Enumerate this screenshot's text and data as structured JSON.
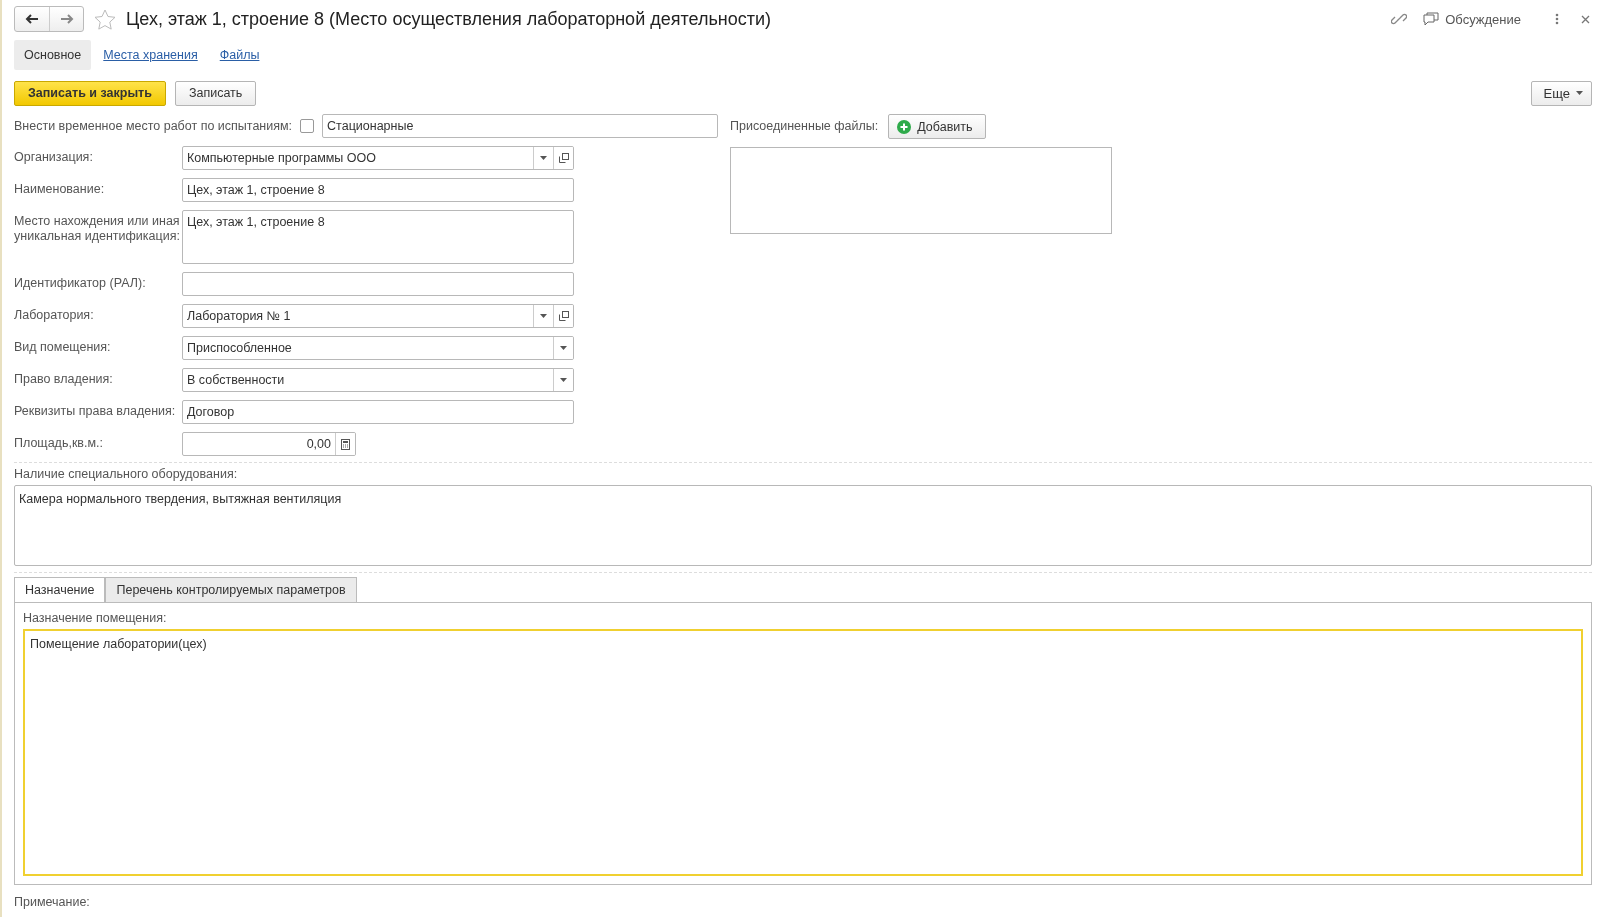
{
  "window": {
    "title": "Цех, этаж 1, строение 8 (Место осуществления лабораторной деятельности)",
    "favorite": false
  },
  "discussion": {
    "label": "Обсуждение"
  },
  "nav_tabs": [
    {
      "label": "Основное",
      "selected": true
    },
    {
      "label": "Места хранения",
      "selected": false
    },
    {
      "label": "Файлы",
      "selected": false
    }
  ],
  "commands": [
    {
      "label": "Записать и закрыть",
      "kind": "primary"
    },
    {
      "label": "Записать",
      "kind": "default"
    }
  ],
  "more_button": {
    "label": "Еще"
  },
  "temp_place": {
    "label": "Внести временное место работ по испытаниям:",
    "checked": false,
    "value": "Стационарные"
  },
  "attached_files": {
    "label": "Присоединенные файлы:",
    "add_button": "Добавить"
  },
  "fields": [
    {
      "kind": "select-open",
      "label": "Организация:",
      "value": "Компьютерные программы ООО"
    },
    {
      "kind": "text",
      "label": "Наименование:",
      "value": "Цех, этаж 1, строение 8"
    },
    {
      "kind": "memo",
      "label": "Место нахождения или иная уникальная идентификация:",
      "value": "Цех, этаж 1, строение 8"
    },
    {
      "kind": "text",
      "label": "Идентификатор (РАЛ):"
    },
    {
      "kind": "select-open",
      "label": "Лаборатория:",
      "value": "Лаборатория № 1"
    },
    {
      "kind": "select",
      "label": "Вид помещения:",
      "value": "Приспособленное"
    },
    {
      "kind": "select",
      "label": "Право владения:",
      "value": "В собственности"
    },
    {
      "kind": "text",
      "label": "Реквизиты права владения:",
      "value": "Договор"
    },
    {
      "kind": "number",
      "label": "Площадь,кв.м.:",
      "value": "0,00"
    }
  ],
  "equipment": {
    "label": "Наличие специального оборудования:",
    "value": "Камера нормального твердения, вытяжная вентиляция"
  },
  "detail_tabs": [
    {
      "label": "Назначение",
      "selected": true
    },
    {
      "label": "Перечень контролируемых параметров",
      "selected": false
    }
  ],
  "purpose": {
    "label": "Назначение помещения:",
    "value": "Помещение лаборатории(цех)"
  },
  "note": {
    "label": "Примечание:"
  }
}
